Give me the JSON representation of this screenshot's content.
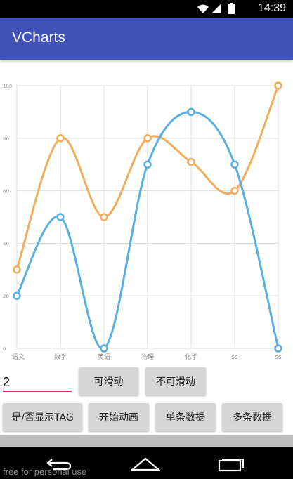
{
  "status": {
    "time": "14:39"
  },
  "app": {
    "title": "VCharts"
  },
  "controls": {
    "input_value": "2",
    "scrollable_label": "可滑动",
    "not_scrollable_label": "不可滑动",
    "toggle_tag_label": "是/否显示TAG",
    "start_animation_label": "开始动画",
    "single_data_label": "单条数据",
    "multi_data_label": "多条数据"
  },
  "watermark": "free for personal use",
  "chart_data": {
    "type": "line",
    "categories": [
      "语文",
      "数学",
      "英语",
      "物理",
      "化学",
      "ss",
      "ss"
    ],
    "y_ticks": [
      "0",
      "20",
      "40",
      "60",
      "80",
      "100"
    ],
    "ylim": [
      0,
      100
    ],
    "smooth": true,
    "grid": true,
    "series": [
      {
        "color": "#5aaee0",
        "values": [
          20,
          50,
          0,
          70,
          90,
          70,
          0
        ]
      },
      {
        "color": "#f0ad5c",
        "values": [
          30,
          80,
          50,
          80,
          71,
          60,
          100
        ]
      }
    ]
  }
}
